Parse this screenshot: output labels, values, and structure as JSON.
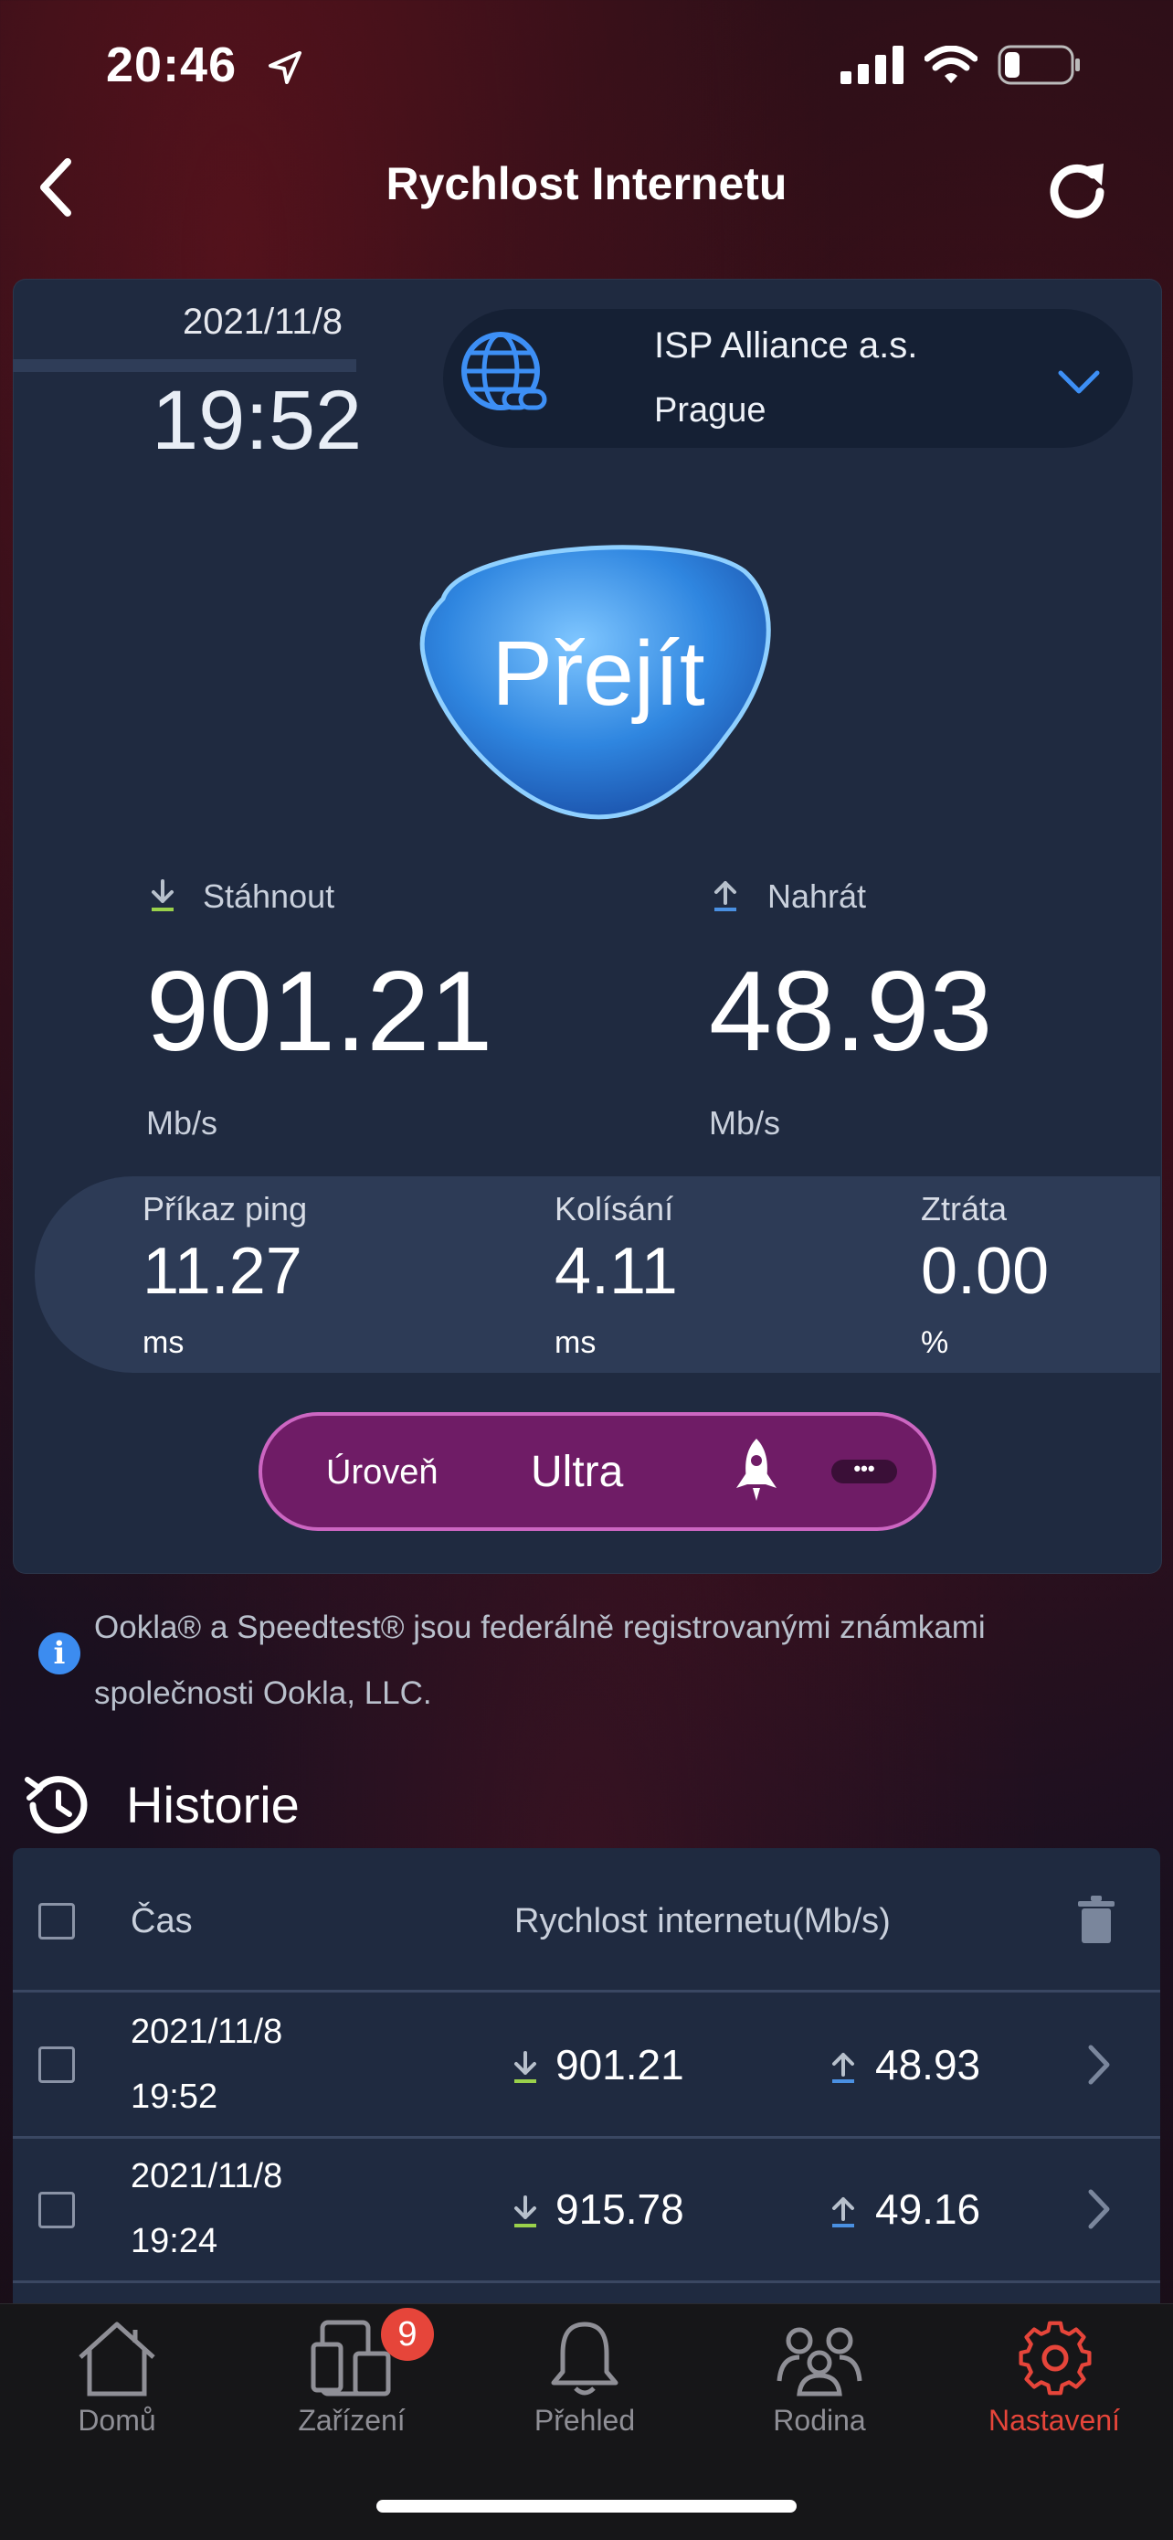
{
  "status_bar": {
    "time": "20:46"
  },
  "header": {
    "title": "Rychlost Internetu",
    "back_icon": "chevron-left-icon",
    "refresh_icon": "refresh-icon"
  },
  "test": {
    "date": "2021/11/8",
    "time": "19:52",
    "isp": {
      "name": "ISP Alliance a.s.",
      "city": "Prague"
    },
    "go_label": "Přejít",
    "download": {
      "label": "Stáhnout",
      "value": "901.21",
      "unit": "Mb/s"
    },
    "upload": {
      "label": "Nahrát",
      "value": "48.93",
      "unit": "Mb/s"
    },
    "ping": {
      "label": "Příkaz ping",
      "value": "11.27",
      "unit": "ms"
    },
    "jitter": {
      "label": "Kolísání",
      "value": "4.11",
      "unit": "ms"
    },
    "loss": {
      "label": "Ztráta",
      "value": "0.00",
      "unit": "%"
    },
    "level": {
      "label": "Úroveň",
      "value": "Ultra",
      "more": "•••"
    }
  },
  "notice": "Ookla® a Speedtest® jsou federálně registrovanými známkami společnosti Ookla, LLC.",
  "history": {
    "title": "Historie",
    "columns": {
      "time": "Čas",
      "speed": "Rychlost internetu(Mb/s)"
    },
    "rows": [
      {
        "date": "2021/11/8",
        "time": "19:52",
        "download": "901.21",
        "upload": "48.93"
      },
      {
        "date": "2021/11/8",
        "time": "19:24",
        "download": "915.78",
        "upload": "49.16"
      }
    ]
  },
  "tabbar": {
    "items": [
      {
        "label": "Domů",
        "icon": "home-icon"
      },
      {
        "label": "Zařízení",
        "icon": "devices-icon",
        "badge": "9"
      },
      {
        "label": "Přehled",
        "icon": "bell-icon"
      },
      {
        "label": "Rodina",
        "icon": "family-icon"
      },
      {
        "label": "Nastavení",
        "icon": "settings-gear-icon",
        "active": true
      }
    ]
  },
  "colors": {
    "accent_red": "#e6453a",
    "download_green": "#9ad14b",
    "upload_blue": "#4a90e2",
    "level_purple": "#6f1c66"
  }
}
